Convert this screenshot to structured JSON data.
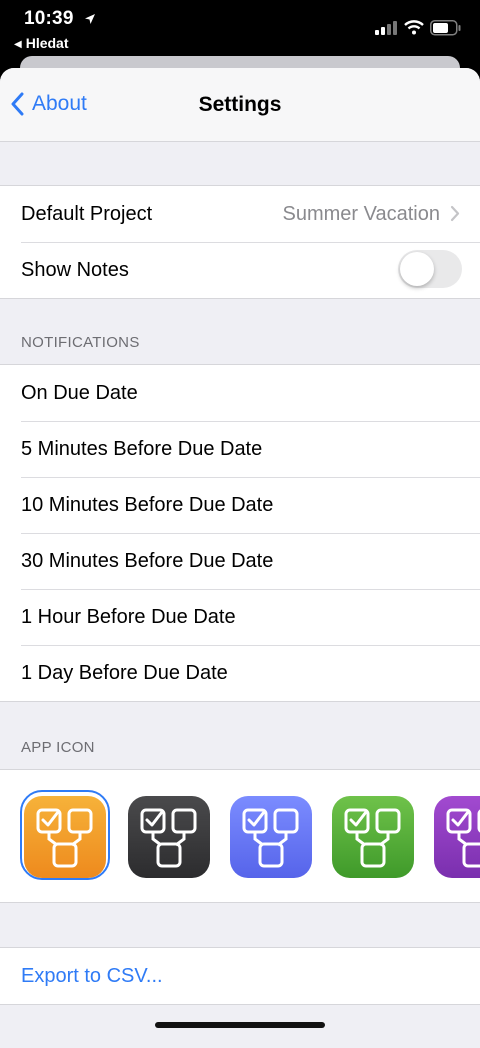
{
  "status_bar": {
    "time": "10:39",
    "back_app": "Hledat"
  },
  "nav": {
    "back_label": "About",
    "title": "Settings"
  },
  "general": {
    "default_project_label": "Default Project",
    "default_project_value": "Summer Vacation",
    "show_notes_label": "Show Notes",
    "show_notes_on": false
  },
  "notifications": {
    "header": "NOTIFICATIONS",
    "items": [
      "On Due Date",
      "5 Minutes Before Due Date",
      "10 Minutes Before Due Date",
      "30 Minutes Before Due Date",
      "1 Hour Before Due Date",
      "1 Day Before Due Date"
    ]
  },
  "app_icon": {
    "header": "APP ICON",
    "icons": [
      {
        "name": "orange",
        "color_top": "#f6b23a",
        "color_bottom": "#ee8a1d",
        "selected": true
      },
      {
        "name": "dark",
        "color_top": "#4a4a4c",
        "color_bottom": "#2c2c2e",
        "selected": false
      },
      {
        "name": "blue",
        "color_top": "#7b8cff",
        "color_bottom": "#5664ea",
        "selected": false
      },
      {
        "name": "green",
        "color_top": "#6fc24a",
        "color_bottom": "#3f9a2a",
        "selected": false
      },
      {
        "name": "purple",
        "color_top": "#a24ad0",
        "color_bottom": "#7a2fae",
        "selected": false
      }
    ]
  },
  "export": {
    "label": "Export to CSV..."
  },
  "colors": {
    "accent": "#2f7bf6",
    "grouped_background": "#efeff4"
  }
}
